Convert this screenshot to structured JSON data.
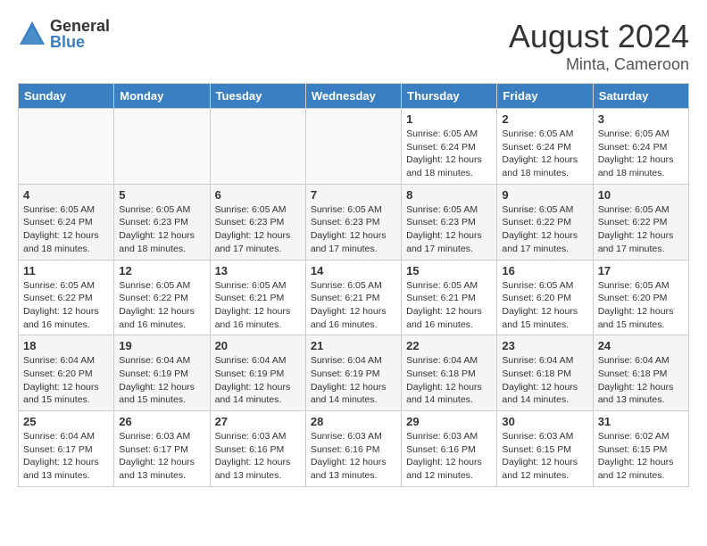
{
  "logo": {
    "general": "General",
    "blue": "Blue"
  },
  "header": {
    "month_year": "August 2024",
    "location": "Minta, Cameroon"
  },
  "weekdays": [
    "Sunday",
    "Monday",
    "Tuesday",
    "Wednesday",
    "Thursday",
    "Friday",
    "Saturday"
  ],
  "weeks": [
    [
      {
        "day": "",
        "info": ""
      },
      {
        "day": "",
        "info": ""
      },
      {
        "day": "",
        "info": ""
      },
      {
        "day": "",
        "info": ""
      },
      {
        "day": "1",
        "info": "Sunrise: 6:05 AM\nSunset: 6:24 PM\nDaylight: 12 hours\nand 18 minutes."
      },
      {
        "day": "2",
        "info": "Sunrise: 6:05 AM\nSunset: 6:24 PM\nDaylight: 12 hours\nand 18 minutes."
      },
      {
        "day": "3",
        "info": "Sunrise: 6:05 AM\nSunset: 6:24 PM\nDaylight: 12 hours\nand 18 minutes."
      }
    ],
    [
      {
        "day": "4",
        "info": "Sunrise: 6:05 AM\nSunset: 6:24 PM\nDaylight: 12 hours\nand 18 minutes."
      },
      {
        "day": "5",
        "info": "Sunrise: 6:05 AM\nSunset: 6:23 PM\nDaylight: 12 hours\nand 18 minutes."
      },
      {
        "day": "6",
        "info": "Sunrise: 6:05 AM\nSunset: 6:23 PM\nDaylight: 12 hours\nand 17 minutes."
      },
      {
        "day": "7",
        "info": "Sunrise: 6:05 AM\nSunset: 6:23 PM\nDaylight: 12 hours\nand 17 minutes."
      },
      {
        "day": "8",
        "info": "Sunrise: 6:05 AM\nSunset: 6:23 PM\nDaylight: 12 hours\nand 17 minutes."
      },
      {
        "day": "9",
        "info": "Sunrise: 6:05 AM\nSunset: 6:22 PM\nDaylight: 12 hours\nand 17 minutes."
      },
      {
        "day": "10",
        "info": "Sunrise: 6:05 AM\nSunset: 6:22 PM\nDaylight: 12 hours\nand 17 minutes."
      }
    ],
    [
      {
        "day": "11",
        "info": "Sunrise: 6:05 AM\nSunset: 6:22 PM\nDaylight: 12 hours\nand 16 minutes."
      },
      {
        "day": "12",
        "info": "Sunrise: 6:05 AM\nSunset: 6:22 PM\nDaylight: 12 hours\nand 16 minutes."
      },
      {
        "day": "13",
        "info": "Sunrise: 6:05 AM\nSunset: 6:21 PM\nDaylight: 12 hours\nand 16 minutes."
      },
      {
        "day": "14",
        "info": "Sunrise: 6:05 AM\nSunset: 6:21 PM\nDaylight: 12 hours\nand 16 minutes."
      },
      {
        "day": "15",
        "info": "Sunrise: 6:05 AM\nSunset: 6:21 PM\nDaylight: 12 hours\nand 16 minutes."
      },
      {
        "day": "16",
        "info": "Sunrise: 6:05 AM\nSunset: 6:20 PM\nDaylight: 12 hours\nand 15 minutes."
      },
      {
        "day": "17",
        "info": "Sunrise: 6:05 AM\nSunset: 6:20 PM\nDaylight: 12 hours\nand 15 minutes."
      }
    ],
    [
      {
        "day": "18",
        "info": "Sunrise: 6:04 AM\nSunset: 6:20 PM\nDaylight: 12 hours\nand 15 minutes."
      },
      {
        "day": "19",
        "info": "Sunrise: 6:04 AM\nSunset: 6:19 PM\nDaylight: 12 hours\nand 15 minutes."
      },
      {
        "day": "20",
        "info": "Sunrise: 6:04 AM\nSunset: 6:19 PM\nDaylight: 12 hours\nand 14 minutes."
      },
      {
        "day": "21",
        "info": "Sunrise: 6:04 AM\nSunset: 6:19 PM\nDaylight: 12 hours\nand 14 minutes."
      },
      {
        "day": "22",
        "info": "Sunrise: 6:04 AM\nSunset: 6:18 PM\nDaylight: 12 hours\nand 14 minutes."
      },
      {
        "day": "23",
        "info": "Sunrise: 6:04 AM\nSunset: 6:18 PM\nDaylight: 12 hours\nand 14 minutes."
      },
      {
        "day": "24",
        "info": "Sunrise: 6:04 AM\nSunset: 6:18 PM\nDaylight: 12 hours\nand 13 minutes."
      }
    ],
    [
      {
        "day": "25",
        "info": "Sunrise: 6:04 AM\nSunset: 6:17 PM\nDaylight: 12 hours\nand 13 minutes."
      },
      {
        "day": "26",
        "info": "Sunrise: 6:03 AM\nSunset: 6:17 PM\nDaylight: 12 hours\nand 13 minutes."
      },
      {
        "day": "27",
        "info": "Sunrise: 6:03 AM\nSunset: 6:16 PM\nDaylight: 12 hours\nand 13 minutes."
      },
      {
        "day": "28",
        "info": "Sunrise: 6:03 AM\nSunset: 6:16 PM\nDaylight: 12 hours\nand 13 minutes."
      },
      {
        "day": "29",
        "info": "Sunrise: 6:03 AM\nSunset: 6:16 PM\nDaylight: 12 hours\nand 12 minutes."
      },
      {
        "day": "30",
        "info": "Sunrise: 6:03 AM\nSunset: 6:15 PM\nDaylight: 12 hours\nand 12 minutes."
      },
      {
        "day": "31",
        "info": "Sunrise: 6:02 AM\nSunset: 6:15 PM\nDaylight: 12 hours\nand 12 minutes."
      }
    ]
  ]
}
